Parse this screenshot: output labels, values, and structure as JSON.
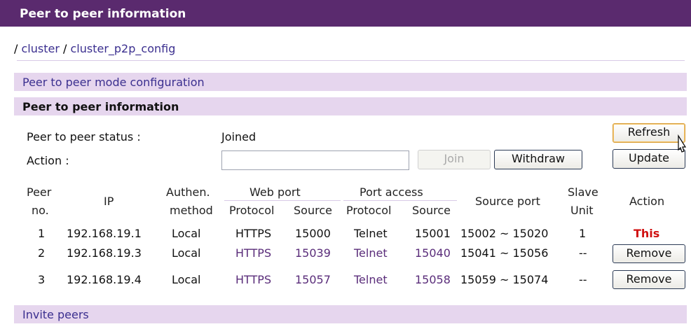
{
  "header": {
    "title": "Peer to peer information"
  },
  "breadcrumb": {
    "sep1": "/",
    "item1": "cluster",
    "sep2": "/",
    "item2": "cluster_p2p_config"
  },
  "sections": {
    "config": "Peer to peer mode configuration",
    "info": "Peer to peer information",
    "invite": "Invite peers"
  },
  "status": {
    "label": "Peer to peer status :",
    "value": "Joined",
    "action_label": "Action :",
    "action_value": ""
  },
  "buttons": {
    "join": "Join",
    "withdraw": "Withdraw",
    "refresh": "Refresh",
    "update": "Update"
  },
  "table": {
    "headers": {
      "peer_no_1": "Peer",
      "peer_no_2": "no.",
      "ip": "IP",
      "authen_1": "Authen.",
      "authen_2": "method",
      "web_port": "Web port",
      "web_protocol": "Protocol",
      "web_source": "Source",
      "port_access": "Port access",
      "pa_protocol": "Protocol",
      "pa_source": "Source",
      "source_port": "Source port",
      "slave_1": "Slave",
      "slave_2": "Unit",
      "action": "Action"
    },
    "rows": [
      {
        "peer_no": "1",
        "ip": "192.168.19.1",
        "auth": "Local",
        "web_protocol": "HTTPS",
        "web_source": "15000",
        "pa_protocol": "Telnet",
        "pa_source": "15001",
        "source_port": "15002 ~ 15020",
        "slave": "1",
        "action": "This"
      },
      {
        "peer_no": "2",
        "ip": "192.168.19.3",
        "auth": "Local",
        "web_protocol": "HTTPS",
        "web_source": "15039",
        "pa_protocol": "Telnet",
        "pa_source": "15040",
        "source_port": "15041 ~ 15056",
        "slave": "--",
        "action": "Remove"
      },
      {
        "peer_no": "3",
        "ip": "192.168.19.4",
        "auth": "Local",
        "web_protocol": "HTTPS",
        "web_source": "15057",
        "pa_protocol": "Telnet",
        "pa_source": "15058",
        "source_port": "15059 ~ 15074",
        "slave": "--",
        "action": "Remove"
      }
    ]
  }
}
